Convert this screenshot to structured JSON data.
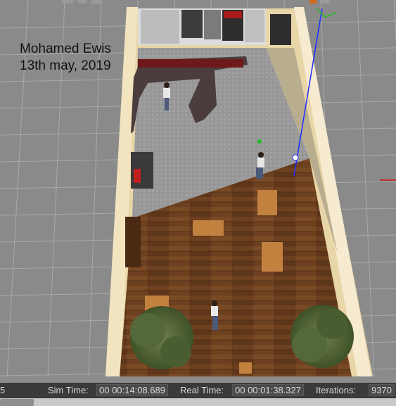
{
  "overlay": {
    "author": "Mohamed Ewis",
    "date": "13th may, 2019"
  },
  "statusbar": {
    "left_fragment": "5",
    "sim_time_label": "Sim Time:",
    "sim_time_value": "00 00:14:08.689",
    "real_time_label": "Real Time:",
    "real_time_value": "00 00:01:38.327",
    "iterations_label": "Iterations:",
    "iterations_value": "9370"
  },
  "colors": {
    "ground": "#8a8a8a",
    "grid_line": "#a9a9a9",
    "wood_floor": "#6b3e1f",
    "grey_floor": "#9a9a9a",
    "wall": "#f3e2b8",
    "axis_blue": "#1e2dff",
    "axis_red": "#d01010",
    "axis_green": "#22c022"
  },
  "icons": [
    "box-tool-icon",
    "sphere-tool-icon",
    "cylinder-tool-icon",
    "light-tool-icon",
    "screenshot-tool-icon"
  ]
}
